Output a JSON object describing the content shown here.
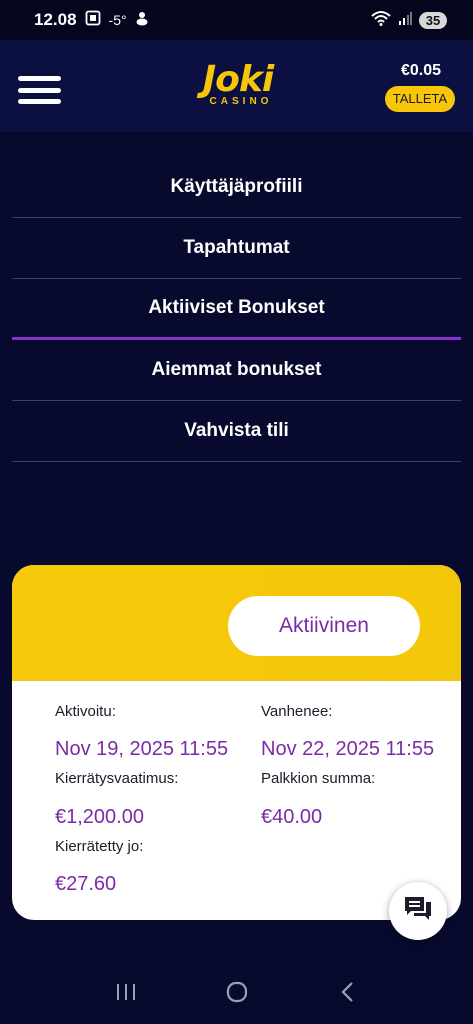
{
  "status_bar": {
    "time": "12.08",
    "temperature": "-5°",
    "battery": "35"
  },
  "header": {
    "logo_text": "Joki",
    "logo_subtext": "CASINO",
    "balance": "€0.05",
    "deposit_label": "TALLETA"
  },
  "menu": {
    "items": [
      {
        "label": "Käyttäjäprofiili"
      },
      {
        "label": "Tapahtumat"
      },
      {
        "label": "Aktiiviset Bonukset"
      },
      {
        "label": "Aiemmat bonukset"
      },
      {
        "label": "Vahvista tili"
      }
    ]
  },
  "bonus": {
    "status": "Aktiivinen",
    "activated_label": "Aktivoitu:",
    "activated_value": "Nov 19, 2025 11:55",
    "expires_label": "Vanhenee:",
    "expires_value": "Nov 22, 2025 11:55",
    "wagering_label": "Kierrätysvaatimus:",
    "wagering_value": "€1,200.00",
    "reward_label": "Palkkion summa:",
    "reward_value": "€40.00",
    "wagered_label": "Kierrätetty jo:",
    "wagered_value": "€27.60"
  },
  "colors": {
    "background": "#070a2c",
    "header": "#0b1040",
    "accent_yellow": "#f7c609",
    "accent_purple": "#7c2ba8",
    "active_underline": "#8a2fd0"
  }
}
